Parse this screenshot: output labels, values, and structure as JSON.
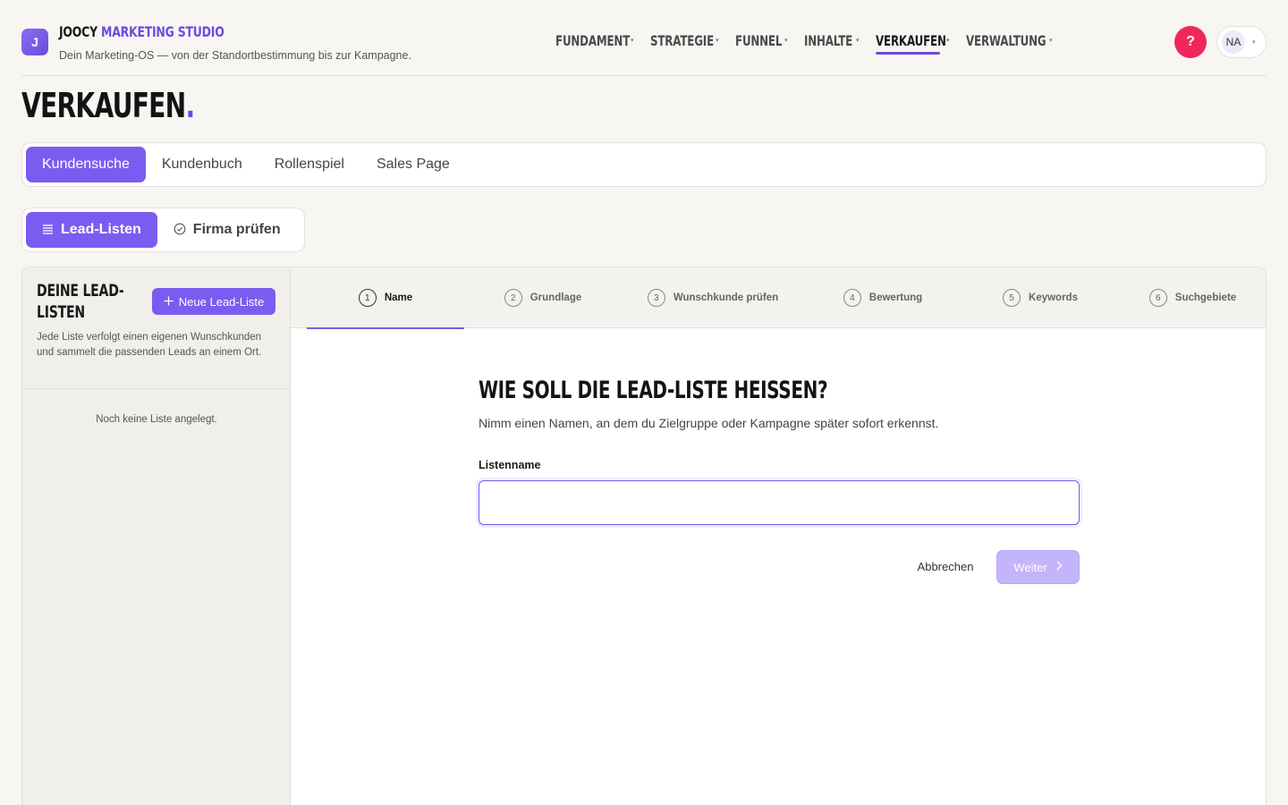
{
  "app": {
    "logo_letter": "J",
    "brand_part1": "JOOCY",
    "brand_part2": "MARKETING STUDIO",
    "tagline": "Dein Marketing-OS — von der Standortbestimmung bis zur Kampagne."
  },
  "nav": {
    "items": [
      {
        "label": "FUNDAMENT",
        "active": false
      },
      {
        "label": "STRATEGIE",
        "active": false
      },
      {
        "label": "FUNNEL",
        "active": false
      },
      {
        "label": "INHALTE",
        "active": false
      },
      {
        "label": "VERKAUFEN",
        "active": true
      },
      {
        "label": "VERWALTUNG",
        "active": false
      }
    ],
    "caret": "▾"
  },
  "header": {
    "help_label": "?",
    "user_initials": "NA"
  },
  "page": {
    "title": "VERKAUFEN",
    "title_dot": "."
  },
  "main_tabs": [
    "Kundensuche",
    "Kundenbuch",
    "Rollenspiel",
    "Sales Page"
  ],
  "sub_tabs": [
    {
      "label": "Lead-Listen",
      "icon": "list-icon"
    },
    {
      "label": "Firma prüfen",
      "icon": "check-circle-icon"
    }
  ],
  "sidebar": {
    "title": "DEINE LEAD-LISTEN",
    "new_button": "Neue Lead-Liste",
    "description": "Jede Liste verfolgt einen eigenen Wunschkunden und sammelt die passenden Leads an einem Ort.",
    "empty_text": "Noch keine Liste angelegt."
  },
  "steps": [
    {
      "num": "1",
      "label": "Name",
      "active": true
    },
    {
      "num": "2",
      "label": "Grundlage",
      "active": false
    },
    {
      "num": "3",
      "label": "Wunschkunde prüfen",
      "active": false
    },
    {
      "num": "4",
      "label": "Bewertung",
      "active": false
    },
    {
      "num": "5",
      "label": "Keywords",
      "active": false
    },
    {
      "num": "6",
      "label": "Suchgebiete",
      "active": false
    }
  ],
  "form": {
    "title": "WIE SOLL DIE LEAD-LISTE HEISSEN?",
    "subtitle": "Nimm einen Namen, an dem du Zielgruppe oder Kampagne später sofort erkennst.",
    "field_label": "Listenname",
    "field_value": "",
    "cancel_label": "Abbrechen",
    "next_label": "Weiter"
  },
  "colors": {
    "accent": "#7b5cf0",
    "help": "#f0285a",
    "background": "#f8f6f2"
  }
}
